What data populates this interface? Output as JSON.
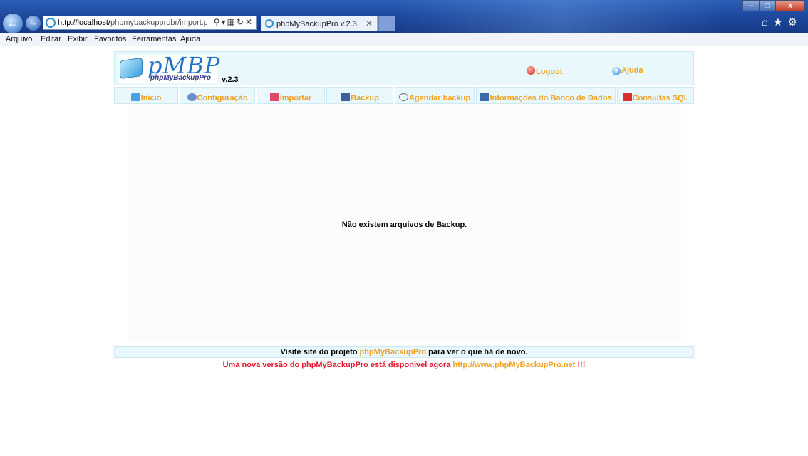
{
  "browser": {
    "address_url_host": "http://localhost/",
    "address_url_path": "phpmybackupprobr/import.ph",
    "tab_title": "phpMyBackupPro v.2.3",
    "menu": [
      "Arquivo",
      "Editar",
      "Exibir",
      "Favoritos",
      "Ferramentas",
      "Ajuda"
    ]
  },
  "header": {
    "logo_text": "pMBP",
    "logo_sub": "phpMyBackupPro",
    "version": "v.2.3",
    "logout": "Logout",
    "help": "Ajuda"
  },
  "nav": [
    {
      "label": "Início"
    },
    {
      "label": "Configuração"
    },
    {
      "label": "Importar"
    },
    {
      "label": "Backup"
    },
    {
      "label": "Agendar backup"
    },
    {
      "label": "Informações do Banco de Dados"
    },
    {
      "label": "Consultas SQL"
    }
  ],
  "main": {
    "message": "Não existem arquivos de Backup."
  },
  "footer": {
    "visit_prefix": "Visite site do projeto ",
    "visit_link": "phpMyBackupPro",
    "visit_suffix": " para ver o que há de novo.",
    "new_version_text": "Uma nova versão do phpMyBackupPro está disponivel agora ",
    "new_version_link": "http://www.phpMyBackupPro.net",
    "new_version_suffix": " !!!"
  },
  "colors": {
    "accent_orange": "#f0a020",
    "panel_blue": "#e8f8fd",
    "alert_red": "#e8102a"
  }
}
